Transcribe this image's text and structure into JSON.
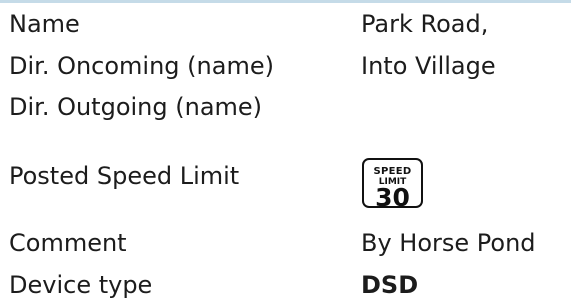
{
  "fields": {
    "name": {
      "label": "Name",
      "value": "Park Road,"
    },
    "dir_oncoming": {
      "label": "Dir. Oncoming (name)",
      "value": "Into Village"
    },
    "dir_outgoing": {
      "label": "Dir. Outgoing (name)",
      "value": ""
    },
    "speed_limit": {
      "label": "Posted Speed Limit",
      "sign_line1": "SPEED",
      "sign_line2": "LIMIT",
      "sign_value": "30"
    },
    "comment": {
      "label": "Comment",
      "value": "By Horse Pond"
    },
    "device_type": {
      "label": "Device type",
      "value": "DSD"
    }
  },
  "colors": {
    "top_rule": "#c5dbe8",
    "text": "#1c1c1c"
  }
}
